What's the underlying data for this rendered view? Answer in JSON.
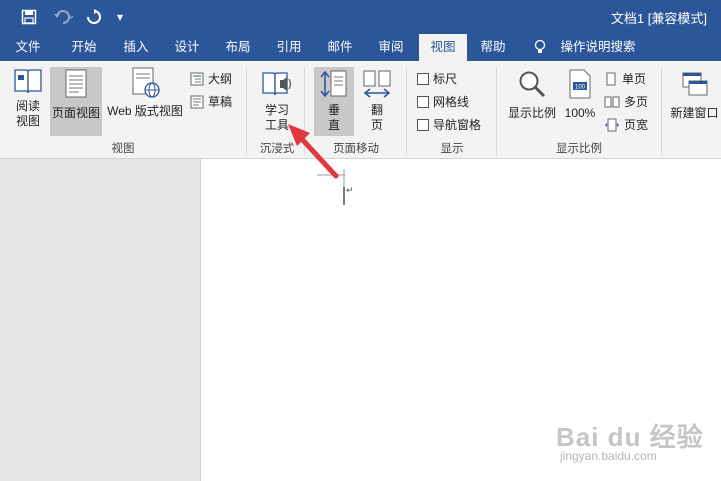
{
  "quick_access": {
    "save_icon": "save-icon",
    "undo_icon": "undo-icon",
    "redo_icon": "redo-icon",
    "customize_icon": "customize-icon"
  },
  "title": "文档1 [兼容模式]",
  "tabs": [
    {
      "label": "文件"
    },
    {
      "label": "开始"
    },
    {
      "label": "插入"
    },
    {
      "label": "设计"
    },
    {
      "label": "布局"
    },
    {
      "label": "引用"
    },
    {
      "label": "邮件"
    },
    {
      "label": "审阅"
    },
    {
      "label": "视图"
    },
    {
      "label": "帮助"
    }
  ],
  "tell_me": "操作说明搜索",
  "ribbon": {
    "view_group": {
      "read_mode": "阅读\n视图",
      "print_layout": "页面视图",
      "web_layout": "Web 版式视图",
      "outline": "大纲",
      "draft": "草稿",
      "label": "视图"
    },
    "immersive_group": {
      "learning_tools": "学习\n工具",
      "label": "沉浸式"
    },
    "page_movement_group": {
      "vertical": "垂\n直",
      "side_to_side": "翻\n页",
      "label": "页面移动"
    },
    "show_group": {
      "ruler": "标尺",
      "gridlines": "网格线",
      "nav_pane": "导航窗格",
      "label": "显示"
    },
    "zoom_group": {
      "zoom": "显示比例",
      "hundred": "100%",
      "one_page": "单页",
      "multiple_pages": "多页",
      "page_width": "页宽",
      "label": "显示比例"
    },
    "window_group": {
      "new_window": "新建窗口"
    }
  },
  "watermark": {
    "brand": "Bai du 经验",
    "url": "jingyan.baidu.com"
  },
  "colors": {
    "title_bar": "#2b579a",
    "ribbon_bg": "#f3f3f3",
    "annotation_arrow": "#e0383e"
  }
}
